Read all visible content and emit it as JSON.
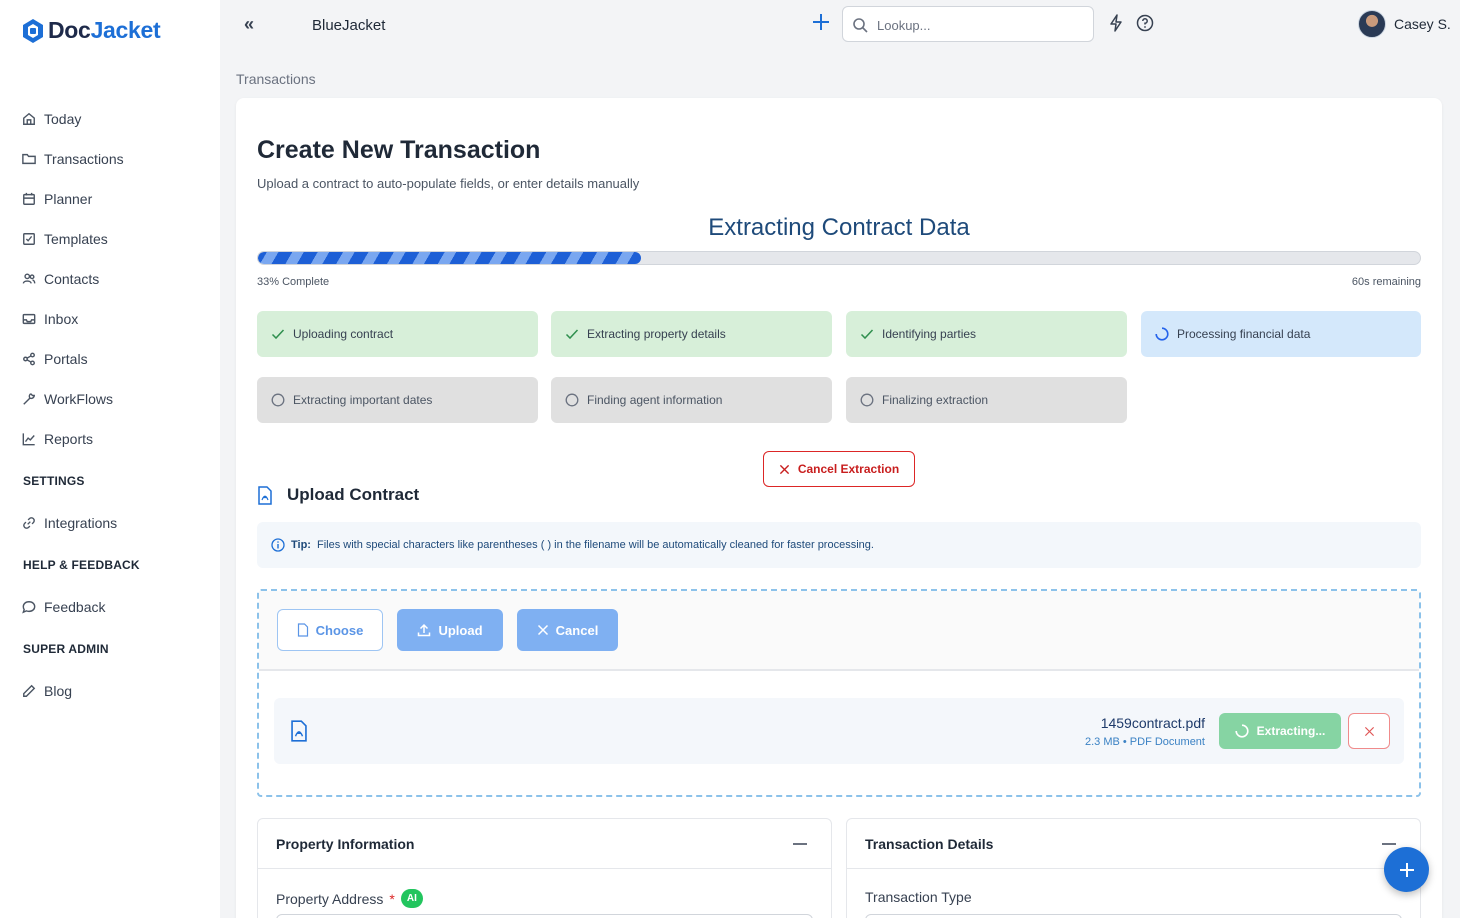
{
  "app": {
    "logo_doc": "Doc",
    "logo_jacket": "Jacket",
    "org_name": "BlueJacket",
    "user_name": "Casey S."
  },
  "search": {
    "placeholder": "Lookup..."
  },
  "sidebar": {
    "items": [
      {
        "label": "Today",
        "icon": "home-icon"
      },
      {
        "label": "Transactions",
        "icon": "folder-icon"
      },
      {
        "label": "Planner",
        "icon": "calendar-icon"
      },
      {
        "label": "Templates",
        "icon": "checkbox-icon"
      },
      {
        "label": "Contacts",
        "icon": "users-icon"
      },
      {
        "label": "Inbox",
        "icon": "mail-icon"
      },
      {
        "label": "Portals",
        "icon": "share-icon"
      },
      {
        "label": "WorkFlows",
        "icon": "wrench-icon"
      },
      {
        "label": "Reports",
        "icon": "chart-icon"
      }
    ],
    "settings_head": "SETTINGS",
    "integrations": "Integrations",
    "help_head": "HELP & FEEDBACK",
    "feedback": "Feedback",
    "admin_head": "SUPER ADMIN",
    "blog": "Blog"
  },
  "breadcrumb": "Transactions",
  "page": {
    "title": "Create New Transaction",
    "subtitle": "Upload a contract to auto-populate fields, or enter details manually"
  },
  "extraction": {
    "title": "Extracting Contract Data",
    "progress_percent": 33,
    "complete_label": "33% Complete",
    "remaining_label": "60s remaining",
    "steps": [
      {
        "label": "Uploading contract",
        "status": "done"
      },
      {
        "label": "Extracting property details",
        "status": "done"
      },
      {
        "label": "Identifying parties",
        "status": "done"
      },
      {
        "label": "Processing financial data",
        "status": "active"
      },
      {
        "label": "Extracting important dates",
        "status": "pending"
      },
      {
        "label": "Finding agent information",
        "status": "pending"
      },
      {
        "label": "Finalizing extraction",
        "status": "pending"
      }
    ],
    "cancel_label": "Cancel Extraction"
  },
  "upload": {
    "title": "Upload Contract",
    "tip_bold": "Tip:",
    "tip_text": "Files with special characters like parentheses ( ) in the filename will be automatically cleaned for faster processing.",
    "choose_label": "Choose",
    "upload_label": "Upload",
    "cancel_label": "Cancel",
    "file": {
      "name": "1459contract.pdf",
      "meta": "2.3 MB • PDF Document",
      "status_label": "Extracting..."
    }
  },
  "panels": {
    "property": {
      "title": "Property Information",
      "field_label": "Property Address",
      "required_mark": "*",
      "ai_badge": "AI"
    },
    "transaction": {
      "title": "Transaction Details",
      "field_label": "Transaction Type"
    }
  },
  "colors": {
    "brand": "#1d6fd6",
    "done": "#d7efd9",
    "active": "#d4e8fb",
    "pending": "#e0e0e0",
    "danger": "#dc2626"
  }
}
